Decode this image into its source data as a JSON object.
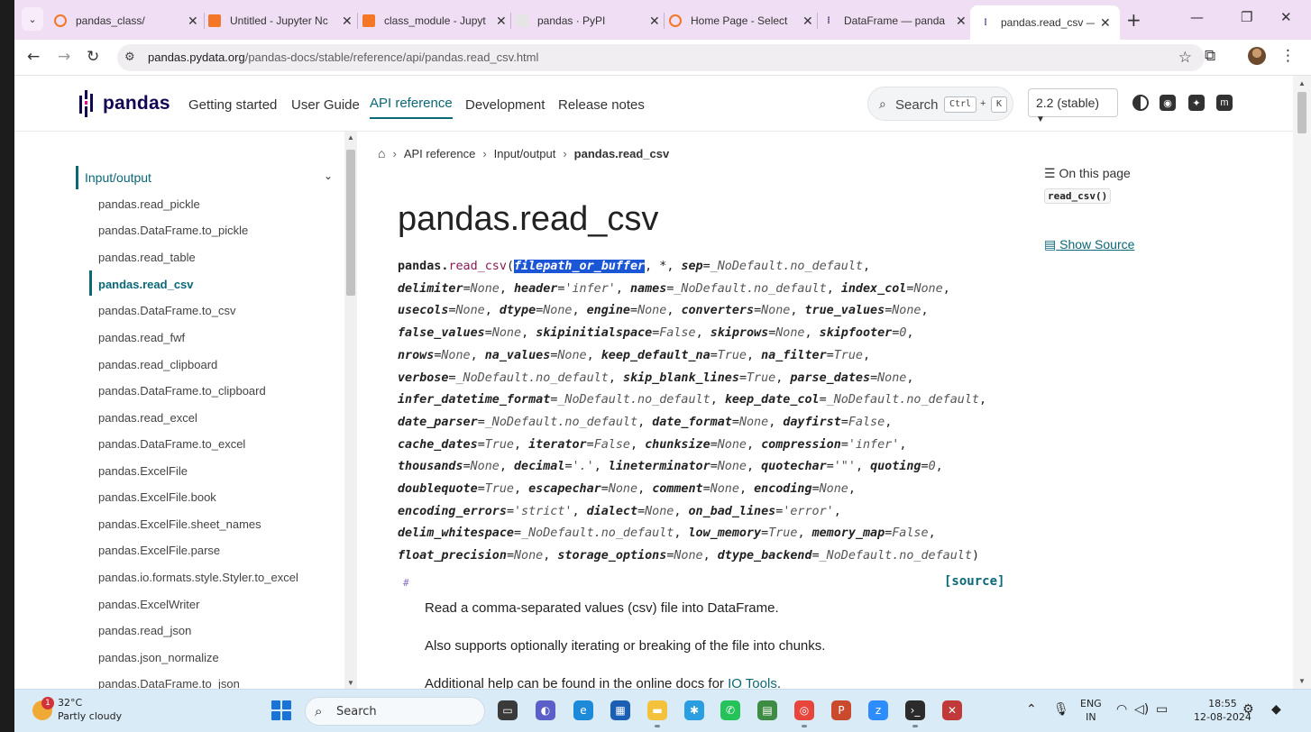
{
  "browser": {
    "tabs": [
      {
        "title": "pandas_class/",
        "icon": "jupyter-icon",
        "active": false
      },
      {
        "title": "Untitled - Jupyter Nc",
        "icon": "notebook-icon",
        "active": false
      },
      {
        "title": "class_module - Jupyt",
        "icon": "notebook-icon",
        "active": false
      },
      {
        "title": "pandas · PyPI",
        "icon": "pypi-icon",
        "active": false
      },
      {
        "title": "Home Page - Select",
        "icon": "jupyter-icon",
        "active": false
      },
      {
        "title": "DataFrame — panda",
        "icon": "pandas-icon",
        "active": false
      },
      {
        "title": "pandas.read_csv — p",
        "icon": "pandas-icon",
        "active": true
      }
    ],
    "url_domain": "pandas.pydata.org",
    "url_path": "/pandas-docs/stable/reference/api/pandas.read_csv.html"
  },
  "site": {
    "logo_text": "pandas",
    "nav": [
      "Getting started",
      "User Guide",
      "API reference",
      "Development",
      "Release notes"
    ],
    "search_label": "Search",
    "search_kbd_1": "Ctrl",
    "search_kbd_plus": "+",
    "search_kbd_2": "K",
    "version": "2.2 (stable)"
  },
  "sidebar": {
    "section": "Input/output",
    "items": [
      "pandas.read_pickle",
      "pandas.DataFrame.to_pickle",
      "pandas.read_table",
      "pandas.read_csv",
      "pandas.DataFrame.to_csv",
      "pandas.read_fwf",
      "pandas.read_clipboard",
      "pandas.DataFrame.to_clipboard",
      "pandas.read_excel",
      "pandas.DataFrame.to_excel",
      "pandas.ExcelFile",
      "pandas.ExcelFile.book",
      "pandas.ExcelFile.sheet_names",
      "pandas.ExcelFile.parse",
      "pandas.io.formats.style.Styler.to_excel",
      "pandas.ExcelWriter",
      "pandas.read_json",
      "pandas.json_normalize",
      "pandas.DataFrame.to_json"
    ],
    "current": "pandas.read_csv"
  },
  "main": {
    "breadcrumb": [
      "API reference",
      "Input/output",
      "pandas.read_csv"
    ],
    "title": "pandas.read_csv",
    "sig_prefix": "pandas.",
    "sig_fn": "read_csv",
    "sig_first_param": "filepath_or_buffer",
    "signature_params": [
      [
        "*",
        ""
      ],
      [
        "sep",
        "_NoDefault.no_default"
      ],
      [
        "delimiter",
        "None"
      ],
      [
        "header",
        "'infer'"
      ],
      [
        "names",
        "_NoDefault.no_default"
      ],
      [
        "index_col",
        "None"
      ],
      [
        "usecols",
        "None"
      ],
      [
        "dtype",
        "None"
      ],
      [
        "engine",
        "None"
      ],
      [
        "converters",
        "None"
      ],
      [
        "true_values",
        "None"
      ],
      [
        "false_values",
        "None"
      ],
      [
        "skipinitialspace",
        "False"
      ],
      [
        "skiprows",
        "None"
      ],
      [
        "skipfooter",
        "0"
      ],
      [
        "nrows",
        "None"
      ],
      [
        "na_values",
        "None"
      ],
      [
        "keep_default_na",
        "True"
      ],
      [
        "na_filter",
        "True"
      ],
      [
        "verbose",
        "_NoDefault.no_default"
      ],
      [
        "skip_blank_lines",
        "True"
      ],
      [
        "parse_dates",
        "None"
      ],
      [
        "infer_datetime_format",
        "_NoDefault.no_default"
      ],
      [
        "keep_date_col",
        "_NoDefault.no_default"
      ],
      [
        "date_parser",
        "_NoDefault.no_default"
      ],
      [
        "date_format",
        "None"
      ],
      [
        "dayfirst",
        "False"
      ],
      [
        "cache_dates",
        "True"
      ],
      [
        "iterator",
        "False"
      ],
      [
        "chunksize",
        "None"
      ],
      [
        "compression",
        "'infer'"
      ],
      [
        "thousands",
        "None"
      ],
      [
        "decimal",
        "'.'"
      ],
      [
        "lineterminator",
        "None"
      ],
      [
        "quotechar",
        "'\"'"
      ],
      [
        "quoting",
        "0"
      ],
      [
        "doublequote",
        "True"
      ],
      [
        "escapechar",
        "None"
      ],
      [
        "comment",
        "None"
      ],
      [
        "encoding",
        "None"
      ],
      [
        "encoding_errors",
        "'strict'"
      ],
      [
        "dialect",
        "None"
      ],
      [
        "on_bad_lines",
        "'error'"
      ],
      [
        "delim_whitespace",
        "_NoDefault.no_default"
      ],
      [
        "low_memory",
        "True"
      ],
      [
        "memory_map",
        "False"
      ],
      [
        "float_precision",
        "None"
      ],
      [
        "storage_options",
        "None"
      ],
      [
        "dtype_backend",
        "_NoDefault.no_default"
      ]
    ],
    "signature_line_breaks": [
      2,
      6,
      11,
      15,
      19,
      22,
      24,
      27,
      31,
      36,
      40,
      43,
      46
    ],
    "headerlink": "#",
    "source_label": "[source]",
    "para1": "Read a comma-separated values (csv) file into DataFrame.",
    "para2": "Also supports optionally iterating or breaking of the file into chunks.",
    "para3_prefix": "Additional help can be found in the online docs for ",
    "para3_link": "IO Tools",
    "para3_suffix": "."
  },
  "toc": {
    "title": "On this page",
    "item": "read_csv()",
    "show_source": "Show Source"
  },
  "taskbar": {
    "weather_temp": "32°C",
    "weather_cond": "Partly cloudy",
    "weather_badge": "1",
    "search": "Search",
    "lang_1": "ENG",
    "lang_2": "IN",
    "time": "18:55",
    "date": "12-08-2024"
  },
  "colors": {
    "accent": "#0a6877",
    "pandas_brand": "#130754",
    "tab_strip": "#f0dff4",
    "taskbar": "#d9ebf7"
  }
}
